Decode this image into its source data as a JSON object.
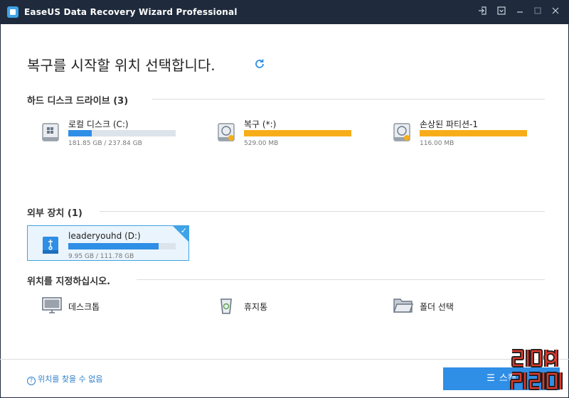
{
  "window": {
    "title": "EaseUS Data Recovery Wizard Professional",
    "buttons": [
      "login-icon",
      "menu-icon",
      "minimize-icon",
      "maximize-icon",
      "close-icon"
    ]
  },
  "heading": "복구를 시작할 위치 선택합니다.",
  "sections": {
    "hard_drives": "하드 디스크 드라이브 (3)",
    "external": "외부 장치 (1)",
    "locations": "위치를 지정하십시오."
  },
  "drives": [
    {
      "name": "로컬 디스크 (C:)",
      "size": "181.85 GB / 237.84 GB",
      "used_fraction": 0.22,
      "color": "#2f8ee5",
      "icon": "windows-drive-icon"
    },
    {
      "name": "복구 (*:)",
      "size": "529.00 MB",
      "used_fraction": 1.0,
      "color": "#f7ad19",
      "icon": "hard-drive-icon"
    },
    {
      "name": "손상된 파티션-1",
      "size": "116.00 MB",
      "used_fraction": 1.0,
      "color": "#f7ad19",
      "icon": "hard-drive-icon"
    }
  ],
  "external_drive": {
    "name": "leaderyouhd (D:)",
    "size": "9.95 GB / 111.78 GB",
    "used_fraction": 0.84,
    "color": "#2f8ee5",
    "icon": "usb-drive-icon"
  },
  "locations": [
    {
      "label": "데스크톱",
      "icon": "desktop-icon"
    },
    {
      "label": "휴지통",
      "icon": "recycle-bin-icon"
    },
    {
      "label": "폴더 선택",
      "icon": "folder-icon"
    }
  ],
  "footer": {
    "help": "위치를 찾을 수 없음",
    "scan": "스캔"
  },
  "colors": {
    "accent": "#2f8ee5",
    "warning": "#f7ad19",
    "titlebar": "#1f2b3c"
  }
}
